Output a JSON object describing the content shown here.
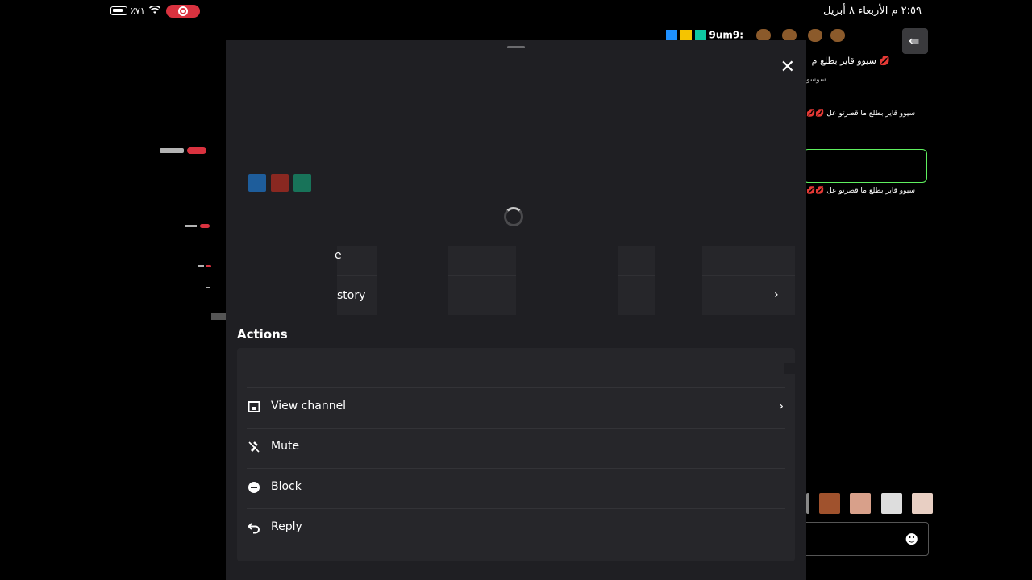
{
  "status_bar": {
    "clock": "٢:٥٩ م  الأربعاء ٨ أبريل",
    "battery_percent": "٪٧١",
    "wifi_icon": "wifi-icon",
    "record_icon": "record-icon"
  },
  "chat": {
    "emote_username": "9um9:",
    "message_1": "سيوو قايز بطلع م",
    "message_1_reply": "سوسو",
    "message_2": "سيوو قايز بطلع ما قصرتو عل",
    "message_3": "سيوو قايز بطلع ما قصرتو عل",
    "collapse_icon": "collapse-chat-icon",
    "emoji_icon": "smiley-icon"
  },
  "modal": {
    "ghost_label_top": "e",
    "ghost_label_bottom": "story",
    "actions_title": "Actions",
    "actions": [
      {
        "label": "View channel",
        "icon": "channel-icon",
        "has_chevron": true
      },
      {
        "label": "Mute",
        "icon": "mute-icon",
        "has_chevron": false
      },
      {
        "label": "Block",
        "icon": "block-icon",
        "has_chevron": false
      },
      {
        "label": "Reply",
        "icon": "reply-icon",
        "has_chevron": false
      }
    ]
  },
  "colors": {
    "background": "#000000",
    "modal": "#1f1f23",
    "card": "#26262a",
    "record_red": "#d9323f",
    "highlight_green": "#5ff05f"
  }
}
